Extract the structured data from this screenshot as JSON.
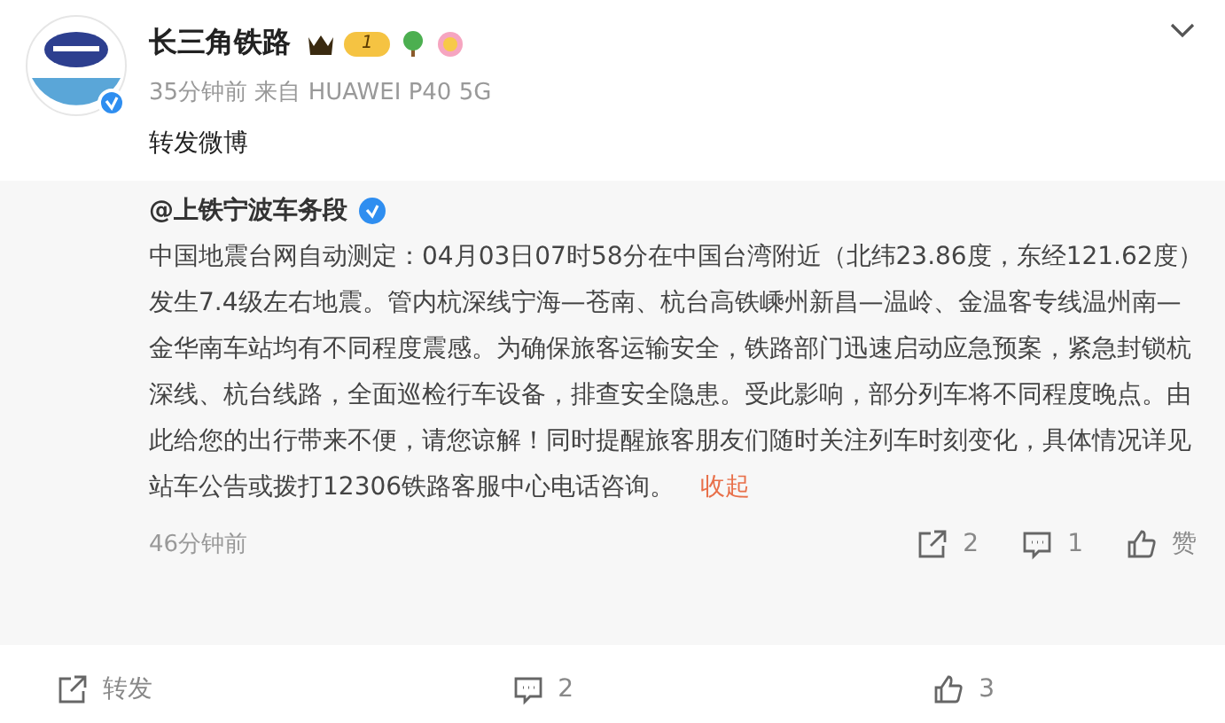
{
  "post": {
    "author": "长三角铁路",
    "vip_level": "1",
    "time": "35分钟前",
    "source": "来自 HUAWEI P40 5G",
    "text": "转发微博"
  },
  "repost": {
    "author": "@上铁宁波车务段",
    "text": "中国地震台网自动测定：04月03日07时58分在中国台湾附近（北纬23.86度，东经121.62度）发生7.4级左右地震。管内杭深线宁海—苍南、杭台高铁嵊州新昌—温岭、金温客专线温州南—金华南车站均有不同程度震感。为确保旅客运输安全，铁路部门迅速启动应急预案，紧急封锁杭深线、杭台线路，全面巡检行车设备，排查安全隐患。受此影响，部分列车将不同程度晚点。由此给您的出行带来不便，请您谅解！同时提醒旅客朋友们随时关注列车时刻变化，具体情况详见站车公告或拨打12306铁路客服中心电话咨询。",
    "collapse_link": "收起",
    "time": "46分钟前",
    "actions": [
      {
        "kind": "repost",
        "label": "2"
      },
      {
        "kind": "comment",
        "label": "1"
      },
      {
        "kind": "like",
        "label": "赞"
      }
    ]
  },
  "actions": [
    {
      "kind": "repost",
      "label": "转发"
    },
    {
      "kind": "comment",
      "label": "2"
    },
    {
      "kind": "like",
      "label": "3"
    }
  ]
}
